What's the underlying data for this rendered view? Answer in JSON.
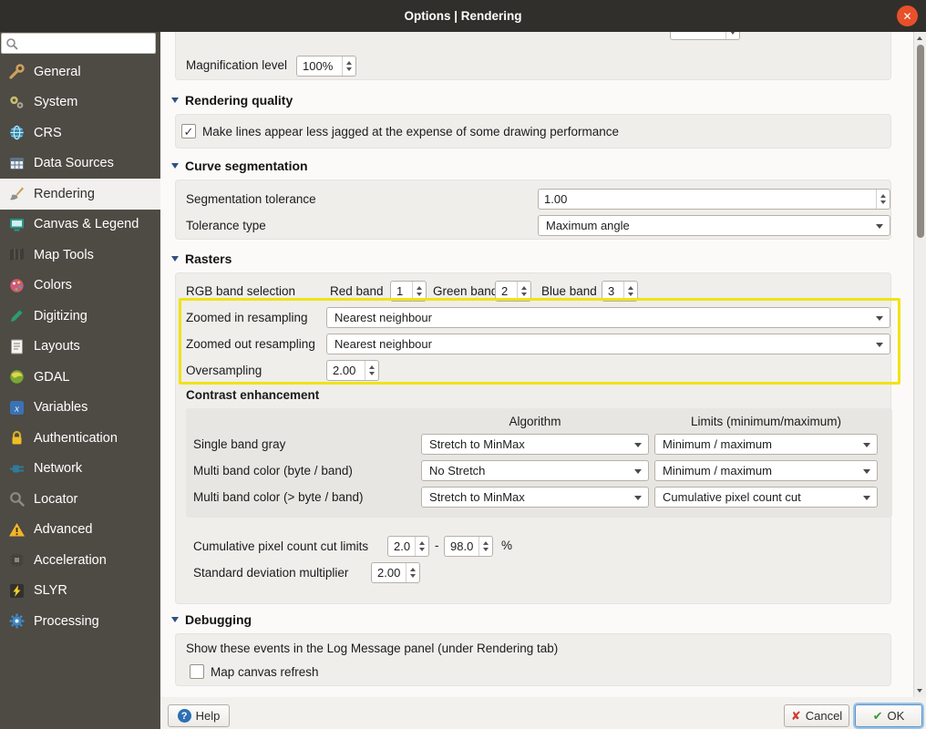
{
  "window": {
    "title": "Options | Rendering"
  },
  "icons": {
    "close": "✕",
    "help": "?",
    "cancel": "✘",
    "ok": "✔"
  },
  "sidebar": {
    "items": [
      {
        "label": "General"
      },
      {
        "label": "System"
      },
      {
        "label": "CRS"
      },
      {
        "label": "Data Sources"
      },
      {
        "label": "Rendering"
      },
      {
        "label": "Canvas & Legend"
      },
      {
        "label": "Map Tools"
      },
      {
        "label": "Colors"
      },
      {
        "label": "Digitizing"
      },
      {
        "label": "Layouts"
      },
      {
        "label": "GDAL"
      },
      {
        "label": "Variables"
      },
      {
        "label": "Authentication"
      },
      {
        "label": "Network"
      },
      {
        "label": "Locator"
      },
      {
        "label": "Advanced"
      },
      {
        "label": "Acceleration"
      },
      {
        "label": "SLYR"
      },
      {
        "label": "Processing"
      }
    ],
    "selected": "Rendering"
  },
  "main": {
    "magnification": {
      "label": "Magnification level",
      "value": "100%"
    },
    "rendering_quality": {
      "title": "Rendering quality",
      "checkbox_label": "Make lines appear less jagged at the expense of some drawing performance",
      "checkbox_checked": true
    },
    "curve_segmentation": {
      "title": "Curve segmentation",
      "tolerance_label": "Segmentation tolerance",
      "tolerance_value": "1.00",
      "type_label": "Tolerance type",
      "type_value": "Maximum angle"
    },
    "rasters": {
      "title": "Rasters",
      "rgb_label": "RGB band selection",
      "red_label": "Red band",
      "red_value": "1",
      "green_label": "Green band",
      "green_value": "2",
      "blue_label": "Blue band",
      "blue_value": "3",
      "zoomed_in_label": "Zoomed in resampling",
      "zoomed_in_value": "Nearest neighbour",
      "zoomed_out_label": "Zoomed out resampling",
      "zoomed_out_value": "Nearest neighbour",
      "oversampling_label": "Oversampling",
      "oversampling_value": "2.00",
      "highlight_color": "#f0e317",
      "contrast": {
        "title": "Contrast enhancement",
        "col_algorithm": "Algorithm",
        "col_limits": "Limits (minimum/maximum)",
        "rows": [
          {
            "label": "Single band gray",
            "algorithm": "Stretch to MinMax",
            "limits": "Minimum / maximum"
          },
          {
            "label": "Multi band color (byte / band)",
            "algorithm": "No Stretch",
            "limits": "Minimum / maximum"
          },
          {
            "label": "Multi band color (> byte / band)",
            "algorithm": "Stretch to MinMax",
            "limits": "Cumulative pixel count cut"
          }
        ],
        "cumulative_label": "Cumulative pixel count cut limits",
        "cumulative_min": "2.0",
        "dash": "-",
        "cumulative_max": "98.0",
        "percent": "%",
        "stddev_label": "Standard deviation multiplier",
        "stddev_value": "2.00"
      }
    },
    "debugging": {
      "title": "Debugging",
      "info": "Show these events in the Log Message panel (under Rendering tab)",
      "checkbox_label": "Map canvas refresh",
      "checkbox_checked": false
    }
  },
  "footer": {
    "help_label": "Help",
    "cancel_label": "Cancel",
    "ok_label": "OK"
  }
}
